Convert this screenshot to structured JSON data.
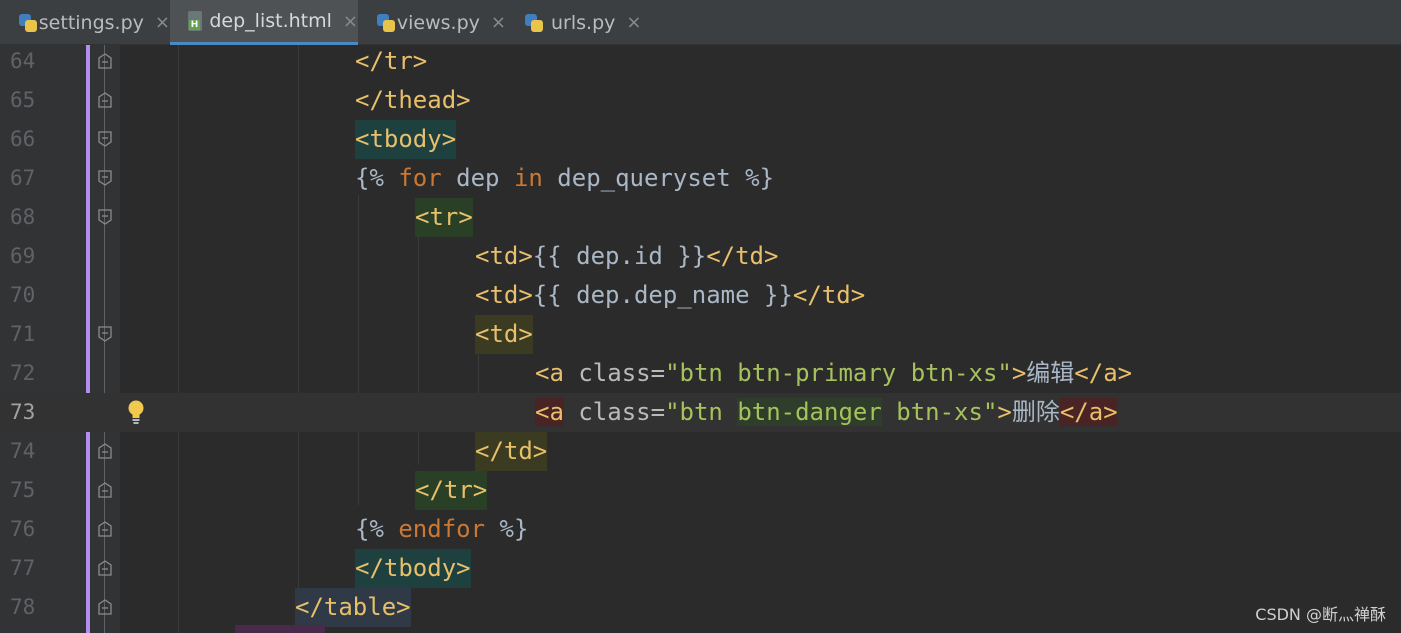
{
  "tabs": [
    {
      "label": "settings.py",
      "icon": "python-file-icon",
      "active": false
    },
    {
      "label": "dep_list.html",
      "icon": "html-file-icon",
      "active": true
    },
    {
      "label": "views.py",
      "icon": "python-file-icon",
      "active": false
    },
    {
      "label": "urls.py",
      "icon": "python-file-icon",
      "active": false
    }
  ],
  "tab_close_glyph": "×",
  "editor": {
    "line_numbers": [
      "64",
      "65",
      "66",
      "67",
      "68",
      "69",
      "70",
      "71",
      "72",
      "73",
      "74",
      "75",
      "76",
      "77",
      "78"
    ],
    "current_line": "73",
    "code": {
      "l64": "</tr>",
      "l65": "</thead>",
      "l66": "<tbody>",
      "l67": {
        "open": "{%",
        "for": " for ",
        "var": "dep ",
        "in": "in",
        "rest": " dep_queryset %}"
      },
      "l68": "<tr>",
      "l69": {
        "open": "<td>",
        "expr": "{{ dep.id }}",
        "close": "</td>"
      },
      "l70": {
        "open": "<td>",
        "expr": "{{ dep.dep_name }}",
        "close": "</td>"
      },
      "l71": "<td>",
      "l72": {
        "open": "<a",
        "attr": " class=",
        "value": "\"btn btn-primary btn-xs\"",
        "gt": ">",
        "text": "编辑",
        "close": "</a>"
      },
      "l73": {
        "open": "<a",
        "attr": " class=",
        "q1": "\"btn ",
        "danger": "btn-danger",
        "q2": " btn-xs\"",
        "gt": ">",
        "text": "删除",
        "close": "</a>"
      },
      "l74": "</td>",
      "l75": "</tr>",
      "l76": {
        "open": "{% ",
        "kw": "endfor",
        "close": " %}"
      },
      "l77": "</tbody>",
      "l78": "</table>"
    }
  },
  "watermark": "CSDN @断灬禅酥",
  "colors": {
    "tag": "#e8bf6a",
    "attribute": "#bababa",
    "string": "#a5c25c",
    "keyword": "#cc7832",
    "text": "#a9b7c6",
    "active_tab_underline": "#4a88c7"
  }
}
